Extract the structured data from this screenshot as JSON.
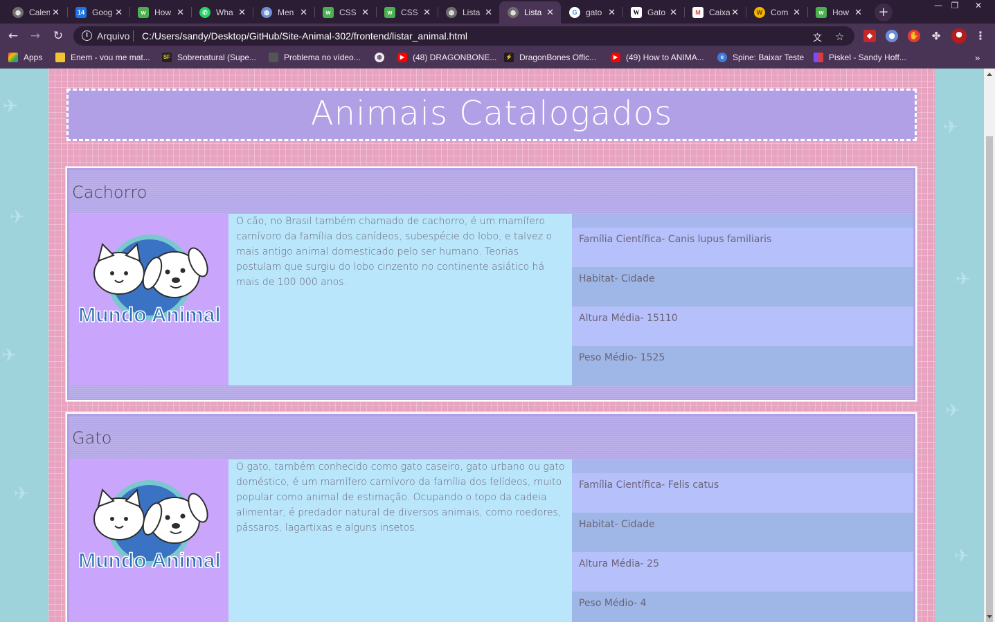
{
  "browser": {
    "tabs": [
      {
        "label": "Calen",
        "icon": "globe-icon",
        "color": "#6d6d6d"
      },
      {
        "label": "Goog",
        "icon": "calendar-icon",
        "color": "#1a73e8"
      },
      {
        "label": "How",
        "icon": "wh-icon",
        "color": "#4caf50"
      },
      {
        "label": "Wha",
        "icon": "whatsapp-icon",
        "color": "#25d366"
      },
      {
        "label": "Men",
        "icon": "globe-icon",
        "color": "#6d8fd6"
      },
      {
        "label": "CSS",
        "icon": "wh-icon",
        "color": "#4caf50"
      },
      {
        "label": "CSS",
        "icon": "wh-icon",
        "color": "#4caf50"
      },
      {
        "label": "Lista",
        "icon": "globe-icon",
        "color": "#6d6d6d"
      },
      {
        "label": "Lista",
        "icon": "globe-icon",
        "color": "#6d6d6d",
        "active": true
      },
      {
        "label": "gato",
        "icon": "google-icon",
        "color": "#ffffff"
      },
      {
        "label": "Gato",
        "icon": "wikipedia-icon",
        "color": "#ffffff"
      },
      {
        "label": "Caixa",
        "icon": "gmail-icon",
        "color": "#ffffff"
      },
      {
        "label": "Com",
        "icon": "coin-icon",
        "color": "#f5b400"
      },
      {
        "label": "How",
        "icon": "wh-icon",
        "color": "#4caf50"
      }
    ],
    "address": {
      "protocol": "Arquivo",
      "url": "C:/Users/sandy/Desktop/GitHub/Site-Animal-302/frontend/listar_animal.html"
    },
    "bookmarks": [
      {
        "label": "Apps",
        "icon": "apps-grid-icon",
        "color": "#ea4335"
      },
      {
        "label": "Enem - vou me mat...",
        "icon": "folder-icon",
        "color": "#f4c430"
      },
      {
        "label": "Sobrenatural (Supe...",
        "icon": "sf-icon",
        "color": "#222222"
      },
      {
        "label": "Problema no vídeo...",
        "icon": "site-icon",
        "color": "#555555"
      },
      {
        "label": "",
        "icon": "globe-icon",
        "color": "#888888"
      },
      {
        "label": "(48) DRAGONBONE...",
        "icon": "youtube-icon",
        "color": "#ff0000"
      },
      {
        "label": "DragonBones Offic...",
        "icon": "dragonbones-icon",
        "color": "#1e1e1e"
      },
      {
        "label": "(49) How to ANIMA...",
        "icon": "youtube-icon",
        "color": "#ff0000"
      },
      {
        "label": "Spine: Baixar Teste",
        "icon": "spine-icon",
        "color": "#3b7dd8"
      },
      {
        "label": "Piskel - Sandy Hoff...",
        "icon": "piskel-icon",
        "color": "#7c4dff"
      }
    ]
  },
  "page": {
    "title": "Animais Catalogados",
    "animals": [
      {
        "name": "Cachorro",
        "logo_text": "Mundo Animal",
        "description": "O cão, no Brasil também chamado de cachorro, é um mamífero carnívoro da família dos canídeos, subespécie do lobo, e talvez o mais antigo animal domesticado pelo ser humano. Teorias postulam que surgiu do lobo cinzento no continente asiático há mais de 100 000 anos.",
        "familia": "Família Científica- Canis lupus familiaris",
        "habitat": "Habitat- Cidade",
        "altura": "Altura Média- 15110",
        "peso": "Peso Médio- 1525"
      },
      {
        "name": "Gato",
        "logo_text": "Mundo Animal",
        "description": "O gato, também conhecido como gato caseiro, gato urbano ou gato doméstico, é um mamífero carnívoro da família dos felídeos, muito popular como animal de estimação. Ocupando o topo da cadeia alimentar, é predador natural de diversos animais, como roedores, pássaros, lagartixas e alguns insetos.",
        "familia": "Família Científica- Felis catus",
        "habitat": "Habitat- Cidade",
        "altura": "Altura Média- 25",
        "peso": "Peso Médio- 4"
      }
    ]
  }
}
